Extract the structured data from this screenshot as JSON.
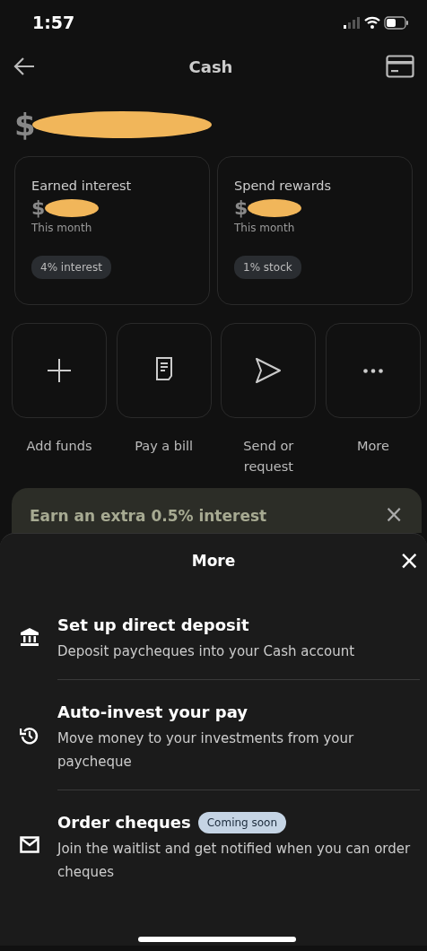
{
  "status_bar": {
    "time": "1:57"
  },
  "header": {
    "title": "Cash"
  },
  "balance": {
    "currency": "$"
  },
  "summary_cards": [
    {
      "title": "Earned interest",
      "currency": "$",
      "period": "This month",
      "tag": "4% interest"
    },
    {
      "title": "Spend rewards",
      "currency": "$",
      "period": "This month",
      "tag": "1% stock"
    }
  ],
  "actions": [
    {
      "kind": "add",
      "label": "Add funds"
    },
    {
      "kind": "bill",
      "label": "Pay a bill"
    },
    {
      "kind": "send",
      "label": "Send or request"
    },
    {
      "kind": "more",
      "label": "More"
    }
  ],
  "banner": {
    "text": "Earn an extra 0.5% interest",
    "close": "×"
  },
  "sheet": {
    "title": "More",
    "close": "×",
    "items": [
      {
        "kind": "bank",
        "title": "Set up direct deposit",
        "description": "Deposit paycheques into your Cash account"
      },
      {
        "kind": "history",
        "title": "Auto-invest your pay",
        "description": "Move money to your investments from your paycheque"
      },
      {
        "kind": "mail",
        "title": "Order cheques",
        "badge": "Coming soon",
        "description": "Join the waitlist and get notified when you can order cheques"
      }
    ]
  }
}
